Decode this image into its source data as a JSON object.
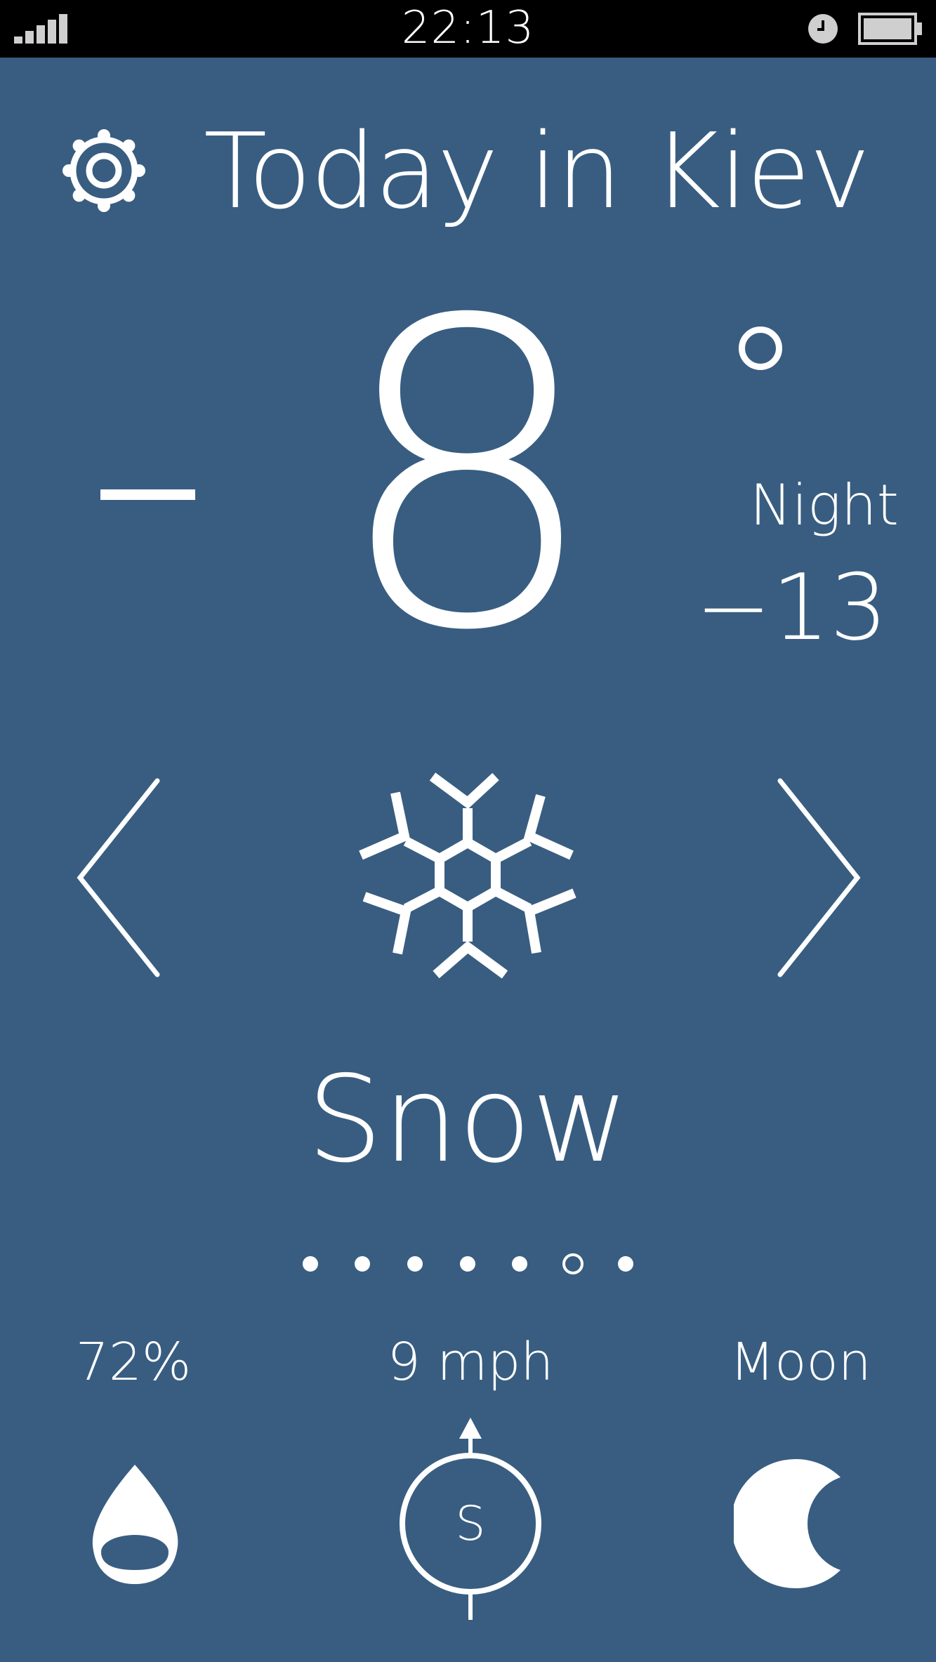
{
  "status_bar": {
    "time": "22:13",
    "icons": [
      "signal-icon",
      "alarm-icon",
      "battery-icon"
    ]
  },
  "header": {
    "title": "Today in Kiev",
    "settings_icon": "gear-icon"
  },
  "current": {
    "sign": "−",
    "temperature": "8",
    "unit_icon": "degree-icon",
    "night_label": "Night",
    "night_temperature": "−13",
    "condition": "Snow",
    "condition_icon": "snowflake-icon"
  },
  "navigation": {
    "prev_icon": "chevron-left-icon",
    "next_icon": "chevron-right-icon"
  },
  "pager": {
    "count": 7,
    "active_index": 5
  },
  "details": {
    "humidity": "72%",
    "humidity_icon": "water-drop-icon",
    "wind": "9 mph",
    "wind_direction": "S",
    "wind_icon": "compass-icon",
    "moon": "Moon",
    "moon_icon": "crescent-moon-icon"
  },
  "colors": {
    "background": "#385d81",
    "status_bar": "#000000",
    "foreground": "#ffffff"
  }
}
